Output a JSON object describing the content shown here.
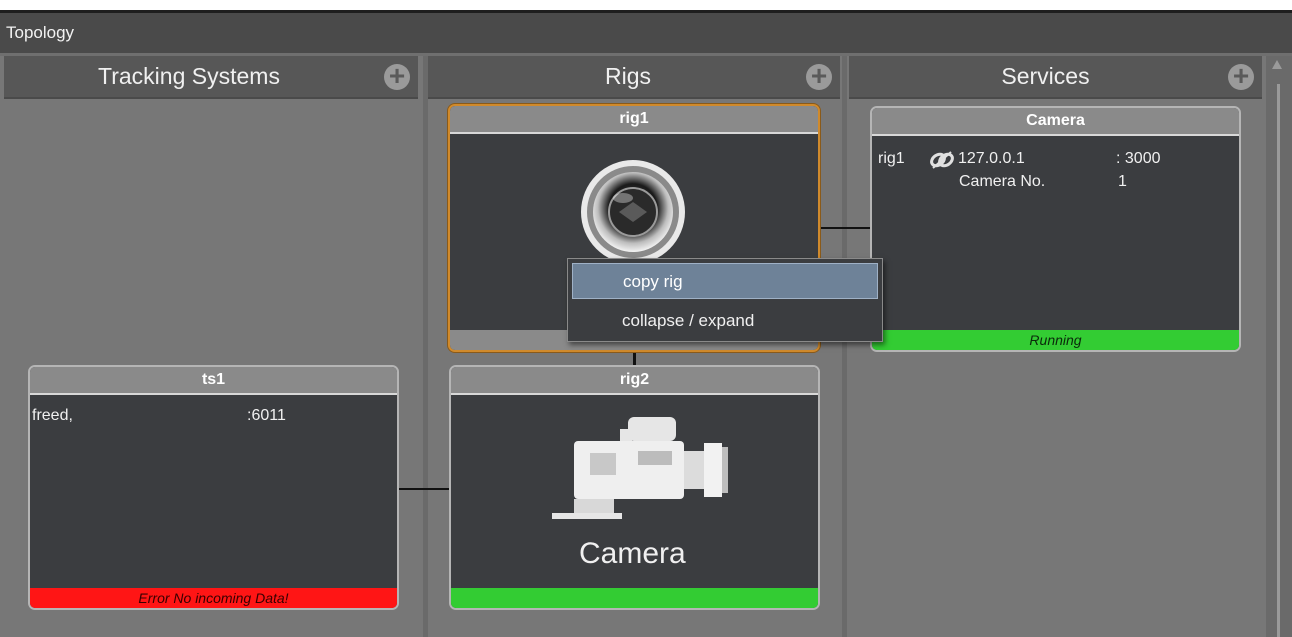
{
  "window": {
    "title": "Topology"
  },
  "columns": [
    {
      "title": "Tracking Systems",
      "add_icon": "plus-circle-icon"
    },
    {
      "title": "Rigs",
      "add_icon": "plus-circle-icon"
    },
    {
      "title": "Services",
      "add_icon": "plus-circle-icon"
    }
  ],
  "tracking_systems": [
    {
      "name": "ts1",
      "protocol": "freed,",
      "port": ":6011",
      "status": "Error No incoming Data!",
      "status_color": "#ff1515"
    }
  ],
  "rigs": [
    {
      "name": "rig1",
      "icon": "lens-icon",
      "selected": true
    },
    {
      "name": "rig2",
      "icon": "film-camera-icon",
      "label": "Camera",
      "status_color": "#33cc33"
    }
  ],
  "services": [
    {
      "name": "Camera",
      "rig": "rig1",
      "link_icon": "unlinked-icon",
      "ip": "127.0.0.1",
      "port": ": 3000",
      "field_label": "Camera No.",
      "field_value": "1",
      "status": "Running",
      "status_color": "#33cc33"
    }
  ],
  "context_menu": {
    "items": [
      {
        "label": "copy rig",
        "active": true
      },
      {
        "label": "collapse / expand",
        "active": false
      }
    ]
  },
  "colors": {
    "selection": "#d08a2c",
    "menu_highlight": "#6e8298"
  }
}
